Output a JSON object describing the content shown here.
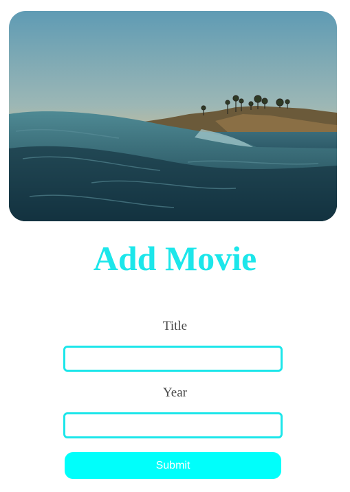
{
  "hero_image": {
    "subject": "ocean wave with coastal cliffs at sunset"
  },
  "page": {
    "title": "Add Movie"
  },
  "form": {
    "title_label": "Title",
    "title_value": "",
    "year_label": "Year",
    "year_value": "",
    "submit_label": "Submit"
  },
  "colors": {
    "accent": "#1ce6ea",
    "button": "#00fffb",
    "label_text": "#4a4a4a"
  }
}
